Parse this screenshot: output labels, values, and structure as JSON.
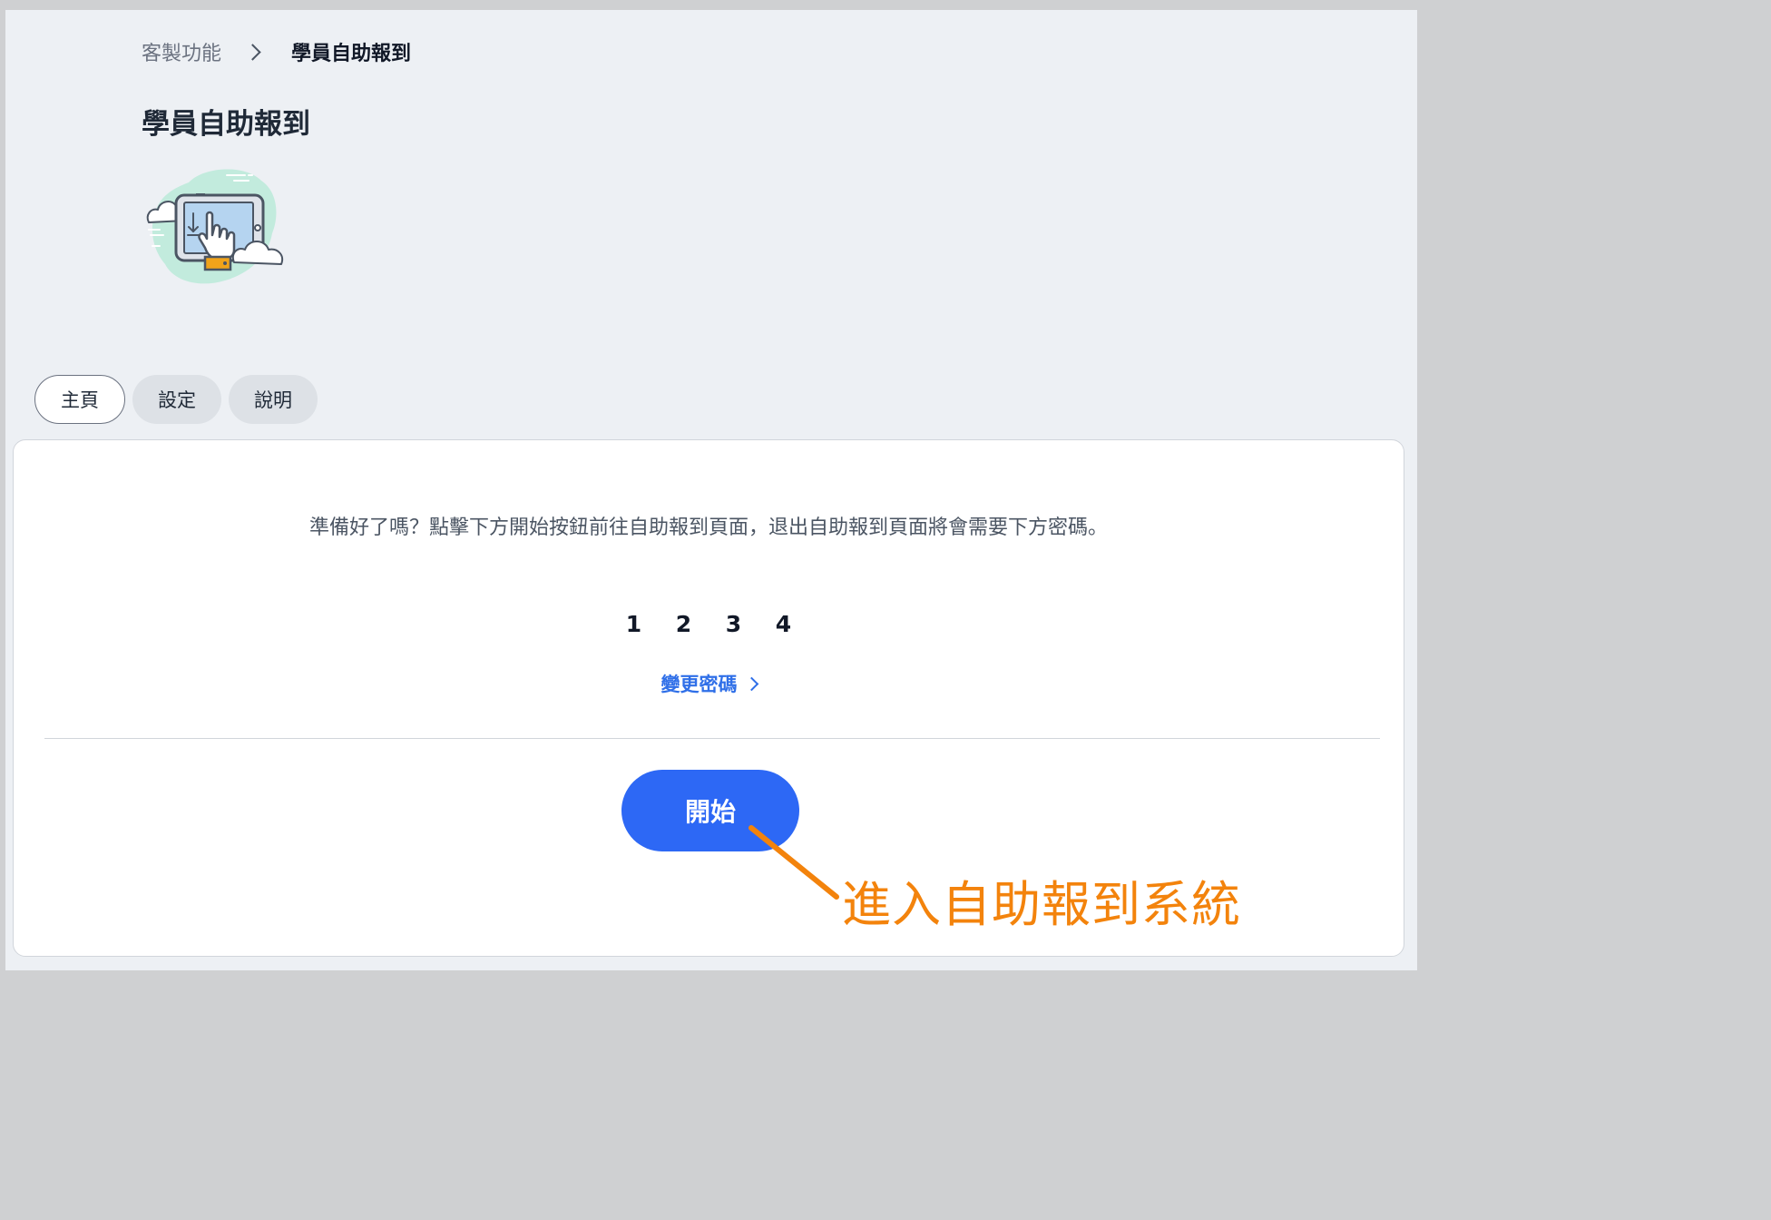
{
  "breadcrumb": {
    "parent": "客製功能",
    "current": "學員自助報到"
  },
  "page": {
    "title": "學員自助報到"
  },
  "tabs": [
    {
      "label": "主頁",
      "active": true
    },
    {
      "label": "設定",
      "active": false
    },
    {
      "label": "說明",
      "active": false
    }
  ],
  "main": {
    "intro": "準備好了嗎？點擊下方開始按鈕前往自助報到頁面，退出自助報到頁面將會需要下方密碼。",
    "password_digits": [
      "1",
      "2",
      "3",
      "4"
    ],
    "change_password_label": "變更密碼",
    "start_button_label": "開始"
  },
  "annotation": {
    "text": "進入自助報到系統",
    "color": "#f3830c"
  },
  "colors": {
    "accent": "#2d68f5",
    "link": "#2f6fe8",
    "background": "#edf0f4"
  },
  "icons": {
    "hero": "tablet-tap-illustration",
    "breadcrumb_separator": "chevron-right-icon",
    "link_chevron": "chevron-right-icon"
  }
}
